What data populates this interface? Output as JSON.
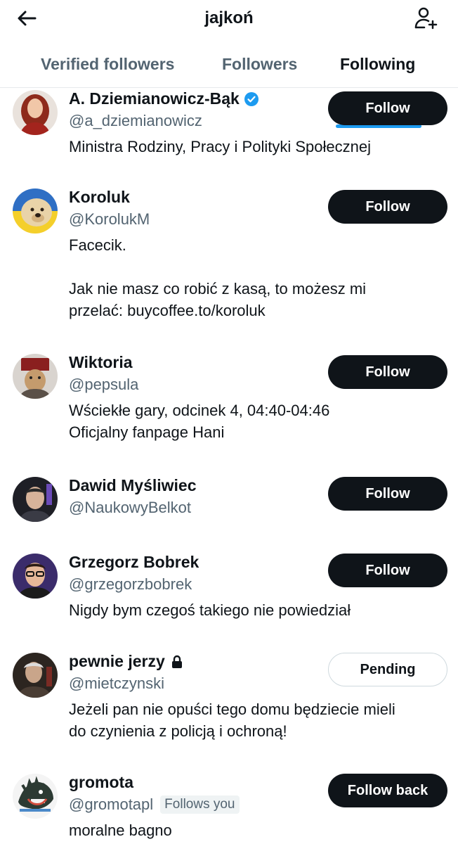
{
  "header": {
    "title": "jajkoń",
    "back_icon": "arrow-left-icon",
    "add_icon": "person-add-icon"
  },
  "tabs": [
    {
      "label": "Verified followers"
    },
    {
      "label": "Followers"
    },
    {
      "label": "Following",
      "active": true
    }
  ],
  "accent_color": "#1d9bf0",
  "users": [
    {
      "name": "A. Dziemianowicz-Bąk",
      "verified": true,
      "handle": "@a_dziemianowicz",
      "bio": "Ministra Rodziny, Pracy i Polityki Społecznej",
      "button": "Follow"
    },
    {
      "name": "Koroluk",
      "handle": "@KorolukM",
      "bio": "Facecik.\n\nJak nie masz co robić z kasą, to możesz mi\nprzelać: buycoffee.to/koroluk",
      "button": "Follow"
    },
    {
      "name": "Wiktoria",
      "handle": "@pepsula",
      "bio": "Wściekłe gary, odcinek 4, 04:40-04:46\nOficjalny fanpage Hani",
      "button": "Follow"
    },
    {
      "name": "Dawid Myśliwiec",
      "handle": "@NaukowyBelkot",
      "bio": "",
      "button": "Follow"
    },
    {
      "name": "Grzegorz Bobrek",
      "handle": "@grzegorzbobrek",
      "bio": "Nigdy bym czegoś takiego nie powiedział",
      "button": "Follow"
    },
    {
      "name": "pewnie jerzy",
      "locked": true,
      "handle": "@mietczynski",
      "bio": "Jeżeli pan nie opuści tego domu będziecie mieli\ndo czynienia z policją i ochroną!",
      "button": "Pending"
    },
    {
      "name": "gromota",
      "handle": "@gromotapl",
      "follows_you": "Follows you",
      "bio": "moralne bagno",
      "button": "Follow back"
    }
  ]
}
